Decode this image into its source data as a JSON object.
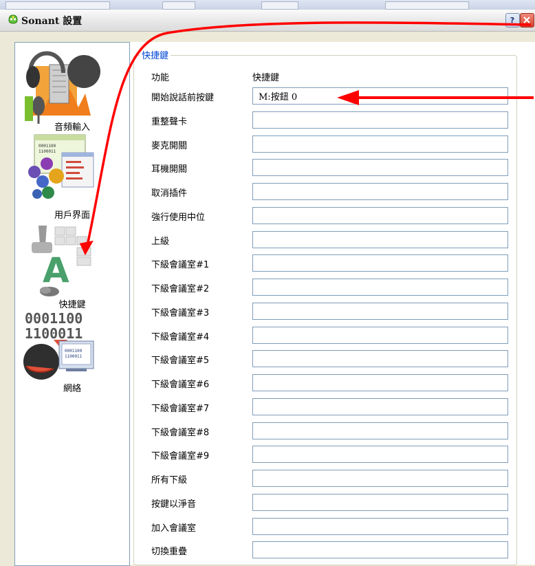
{
  "window": {
    "title": "Sonant 設置",
    "title_icon": "sonant-logo-icon",
    "buttons": {
      "help_icon": "help-icon",
      "close_icon": "close-icon"
    }
  },
  "sidebar": {
    "items": [
      {
        "label": "音頻輸入",
        "icon": "audio-input-icon"
      },
      {
        "label": "用戶界面",
        "icon": "user-interface-icon"
      },
      {
        "label": "快捷鍵",
        "icon": "hotkeys-icon",
        "selected": true
      },
      {
        "label": "網絡",
        "icon": "network-icon"
      }
    ]
  },
  "hotkeys": {
    "group_title": "快捷鍵",
    "header_function": "功能",
    "header_hotkey": "快捷鍵",
    "rows": [
      {
        "label": "開始說話前按鍵",
        "value": "M:按鈕 0"
      },
      {
        "label": "重整聲卡",
        "value": ""
      },
      {
        "label": "麥克開關",
        "value": ""
      },
      {
        "label": "耳機開關",
        "value": ""
      },
      {
        "label": "取消插件",
        "value": ""
      },
      {
        "label": "強行使用中位",
        "value": ""
      },
      {
        "label": "上級",
        "value": ""
      },
      {
        "label": "下級會議室#1",
        "value": ""
      },
      {
        "label": "下級會議室#2",
        "value": ""
      },
      {
        "label": "下級會議室#3",
        "value": ""
      },
      {
        "label": "下級會議室#4",
        "value": ""
      },
      {
        "label": "下級會議室#5",
        "value": ""
      },
      {
        "label": "下級會議室#6",
        "value": ""
      },
      {
        "label": "下級會議室#7",
        "value": ""
      },
      {
        "label": "下級會議室#8",
        "value": ""
      },
      {
        "label": "下級會議室#9",
        "value": ""
      },
      {
        "label": "所有下級",
        "value": ""
      },
      {
        "label": "按鍵以淨音",
        "value": ""
      },
      {
        "label": "加入會議室",
        "value": ""
      },
      {
        "label": "切換重疊",
        "value": ""
      }
    ]
  },
  "annotations": {
    "arrow_color": "#ff0000"
  }
}
